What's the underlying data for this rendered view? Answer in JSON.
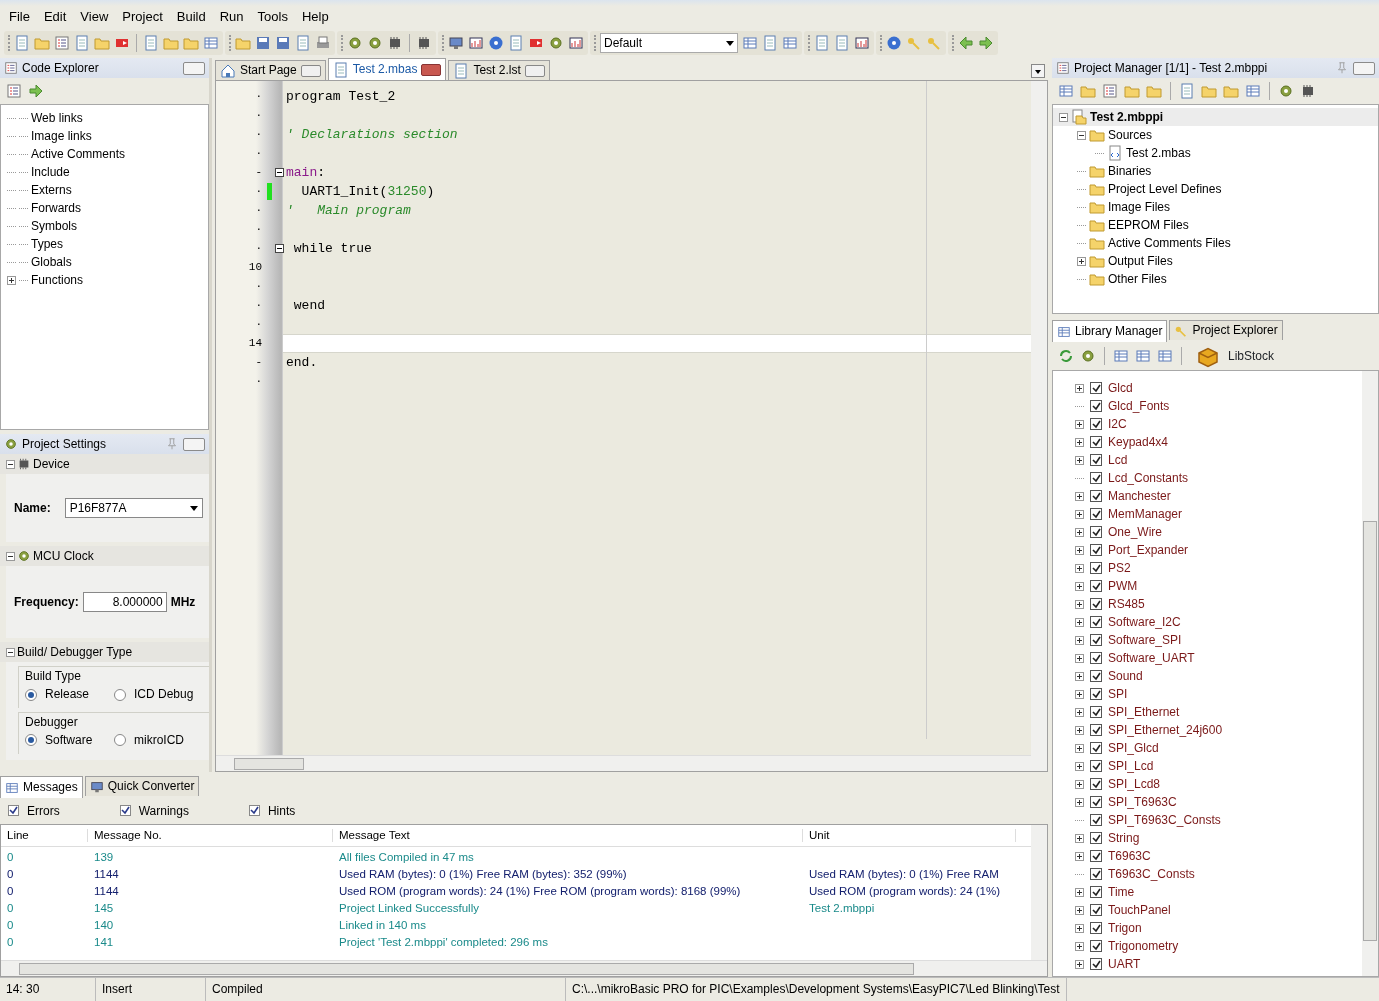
{
  "menu": [
    "File",
    "Edit",
    "View",
    "Project",
    "Build",
    "Run",
    "Tools",
    "Help"
  ],
  "toolbar": {
    "scheme": "Default"
  },
  "code_explorer": {
    "title": "Code Explorer",
    "items": [
      {
        "label": "Web links",
        "expandable": false
      },
      {
        "label": "Image links",
        "expandable": false
      },
      {
        "label": "Active Comments",
        "expandable": false
      },
      {
        "label": "Include",
        "expandable": false
      },
      {
        "label": "Externs",
        "expandable": false
      },
      {
        "label": "Forwards",
        "expandable": false
      },
      {
        "label": "Symbols",
        "expandable": false
      },
      {
        "label": "Types",
        "expandable": false
      },
      {
        "label": "Globals",
        "expandable": false
      },
      {
        "label": "Functions",
        "expandable": true
      }
    ]
  },
  "project_settings": {
    "title": "Project Settings",
    "device": {
      "title": "Device",
      "name_label": "Name:",
      "name": "P16F877A"
    },
    "clock": {
      "title": "MCU Clock",
      "label": "Frequency:",
      "value": "8.000000",
      "unit": "MHz"
    },
    "build": {
      "title": "Build/ Debugger Type",
      "groups": [
        {
          "label": "Build Type",
          "options": [
            {
              "label": "Release",
              "selected": true
            },
            {
              "label": "ICD Debug",
              "selected": false
            }
          ]
        },
        {
          "label": "Debugger",
          "options": [
            {
              "label": "Software",
              "selected": true
            },
            {
              "label": "mikroICD",
              "selected": false
            }
          ]
        }
      ]
    }
  },
  "editor": {
    "tabs": [
      {
        "label": "Start Page",
        "kind": "home",
        "selected": false
      },
      {
        "label": "Test 2.mbas",
        "kind": "file",
        "selected": true
      },
      {
        "label": "Test 2.lst",
        "kind": "file",
        "selected": false
      }
    ],
    "lines": [
      {
        "gutter": "·",
        "fold": false,
        "modified": false,
        "current": false,
        "tokens": [
          {
            "text": "program Test_2",
            "kind": "plain"
          }
        ]
      },
      {
        "gutter": "·",
        "fold": false,
        "modified": false,
        "current": false
      },
      {
        "gutter": "·",
        "fold": false,
        "modified": false,
        "current": false,
        "tokens": [
          {
            "text": "' Declarations section",
            "kind": "comment"
          }
        ]
      },
      {
        "gutter": "·",
        "fold": false,
        "modified": false,
        "current": false
      },
      {
        "gutter": "-",
        "fold": true,
        "modified": false,
        "current": false,
        "tokens": [
          {
            "text": "main",
            "kind": "label"
          },
          {
            "text": ":",
            "kind": "plain"
          }
        ]
      },
      {
        "gutter": "·",
        "fold": false,
        "modified": true,
        "current": false,
        "tokens": [
          {
            "text": "  UART1_Init(",
            "kind": "plain"
          },
          {
            "text": "31250",
            "kind": "number"
          },
          {
            "text": ")",
            "kind": "plain"
          }
        ]
      },
      {
        "gutter": "·",
        "fold": false,
        "modified": false,
        "current": false,
        "tokens": [
          {
            "text": "'   Main program",
            "kind": "comment"
          }
        ]
      },
      {
        "gutter": "·",
        "fold": false,
        "modified": false,
        "current": false
      },
      {
        "gutter": "·",
        "fold": true,
        "modified": false,
        "current": false,
        "tokens": [
          {
            "text": " while true",
            "kind": "plain"
          }
        ]
      },
      {
        "gutter": "10",
        "fold": false,
        "modified": false,
        "current": false
      },
      {
        "gutter": "·",
        "fold": false,
        "modified": false,
        "current": false
      },
      {
        "gutter": "·",
        "fold": false,
        "modified": false,
        "current": false,
        "tokens": [
          {
            "text": " wend",
            "kind": "plain"
          }
        ]
      },
      {
        "gutter": "·",
        "fold": false,
        "modified": false,
        "current": false
      },
      {
        "gutter": "14",
        "fold": false,
        "modified": false,
        "current": true
      },
      {
        "gutter": "-",
        "fold": false,
        "modified": false,
        "current": false,
        "tokens": [
          {
            "text": "end.",
            "kind": "plain"
          }
        ]
      },
      {
        "gutter": "·",
        "fold": false,
        "modified": false,
        "current": false
      }
    ]
  },
  "messages": {
    "tabs": [
      {
        "label": "Messages",
        "selected": true
      },
      {
        "label": "Quick Converter",
        "selected": false
      }
    ],
    "filters": [
      {
        "label": "Errors",
        "checked": true
      },
      {
        "label": "Warnings",
        "checked": true
      },
      {
        "label": "Hints",
        "checked": true
      }
    ],
    "columns": [
      "Line",
      "Message No.",
      "Message Text",
      "Unit"
    ],
    "rows": [
      {
        "line": "0",
        "number": "139",
        "text": "All files Compiled in 47 ms",
        "color": "#1a8a8a"
      },
      {
        "line": "0",
        "number": "1144",
        "text": "Used RAM (bytes): 0 (1%)  Free RAM (bytes): 352 (99%)",
        "unit": "Used RAM (bytes): 0 (1%)  Free RAM",
        "color": "#14206e"
      },
      {
        "line": "0",
        "number": "1144",
        "text": "Used ROM (program words): 24 (1%)  Free ROM (program words): 8168 (99%)",
        "unit": "Used ROM (program words): 24 (1%)",
        "color": "#14206e"
      },
      {
        "line": "0",
        "number": "145",
        "text": "Project Linked Successfully",
        "unit": "Test 2.mbppi",
        "color": "#1a8a8a"
      },
      {
        "line": "0",
        "number": "140",
        "text": "Linked in 140 ms",
        "color": "#1a8a8a"
      },
      {
        "line": "0",
        "number": "141",
        "text": "Project 'Test 2.mbppi' completed: 296 ms",
        "color": "#1a8a8a"
      }
    ]
  },
  "project_manager": {
    "title": "Project Manager [1/1] - Test 2.mbppi",
    "tree": {
      "label": "Test 2.mbppi",
      "kind": "project",
      "expanded": true,
      "children": [
        {
          "label": "Sources",
          "kind": "folder",
          "expanded": true,
          "children": [
            {
              "label": "Test 2.mbas",
              "kind": "source"
            }
          ]
        },
        {
          "label": "Binaries",
          "kind": "folder"
        },
        {
          "label": "Project Level Defines",
          "kind": "folder"
        },
        {
          "label": "Image Files",
          "kind": "folder"
        },
        {
          "label": "EEPROM Files",
          "kind": "folder"
        },
        {
          "label": "Active Comments Files",
          "kind": "folder"
        },
        {
          "label": "Output Files",
          "kind": "folder",
          "expanded": false
        },
        {
          "label": "Other Files",
          "kind": "folder"
        }
      ]
    }
  },
  "library_manager": {
    "tabs": [
      {
        "label": "Library Manager",
        "selected": true
      },
      {
        "label": "Project Explorer",
        "selected": false
      }
    ],
    "libstock": "LibStock",
    "libraries": [
      {
        "label": "Glcd",
        "expandable": true,
        "checked": true
      },
      {
        "label": "Glcd_Fonts",
        "expandable": false,
        "checked": true
      },
      {
        "label": "I2C",
        "expandable": true,
        "checked": true
      },
      {
        "label": "Keypad4x4",
        "expandable": true,
        "checked": true
      },
      {
        "label": "Lcd",
        "expandable": true,
        "checked": true
      },
      {
        "label": "Lcd_Constants",
        "expandable": false,
        "checked": true
      },
      {
        "label": "Manchester",
        "expandable": true,
        "checked": true
      },
      {
        "label": "MemManager",
        "expandable": true,
        "checked": true
      },
      {
        "label": "One_Wire",
        "expandable": true,
        "checked": true
      },
      {
        "label": "Port_Expander",
        "expandable": true,
        "checked": true
      },
      {
        "label": "PS2",
        "expandable": true,
        "checked": true
      },
      {
        "label": "PWM",
        "expandable": true,
        "checked": true
      },
      {
        "label": "RS485",
        "expandable": true,
        "checked": true
      },
      {
        "label": "Software_I2C",
        "expandable": true,
        "checked": true
      },
      {
        "label": "Software_SPI",
        "expandable": true,
        "checked": true
      },
      {
        "label": "Software_UART",
        "expandable": true,
        "checked": true
      },
      {
        "label": "Sound",
        "expandable": true,
        "checked": true
      },
      {
        "label": "SPI",
        "expandable": true,
        "checked": true
      },
      {
        "label": "SPI_Ethernet",
        "expandable": true,
        "checked": true
      },
      {
        "label": "SPI_Ethernet_24j600",
        "expandable": true,
        "checked": true
      },
      {
        "label": "SPI_Glcd",
        "expandable": true,
        "checked": true
      },
      {
        "label": "SPI_Lcd",
        "expandable": true,
        "checked": true
      },
      {
        "label": "SPI_Lcd8",
        "expandable": true,
        "checked": true
      },
      {
        "label": "SPI_T6963C",
        "expandable": true,
        "checked": true
      },
      {
        "label": "SPI_T6963C_Consts",
        "expandable": false,
        "checked": true
      },
      {
        "label": "String",
        "expandable": true,
        "checked": true
      },
      {
        "label": "T6963C",
        "expandable": true,
        "checked": true
      },
      {
        "label": "T6963C_Consts",
        "expandable": false,
        "checked": true
      },
      {
        "label": "Time",
        "expandable": true,
        "checked": true
      },
      {
        "label": "TouchPanel",
        "expandable": true,
        "checked": true
      },
      {
        "label": "Trigon",
        "expandable": true,
        "checked": true
      },
      {
        "label": "Trigonometry",
        "expandable": true,
        "checked": true
      },
      {
        "label": "UART",
        "expandable": true,
        "checked": true
      }
    ]
  },
  "status_bar": [
    "14: 30",
    "Insert",
    "Compiled",
    "C:\\...\\mikroBasic PRO for PIC\\Examples\\Development Systems\\EasyPIC7\\Led Blinking\\Test"
  ]
}
